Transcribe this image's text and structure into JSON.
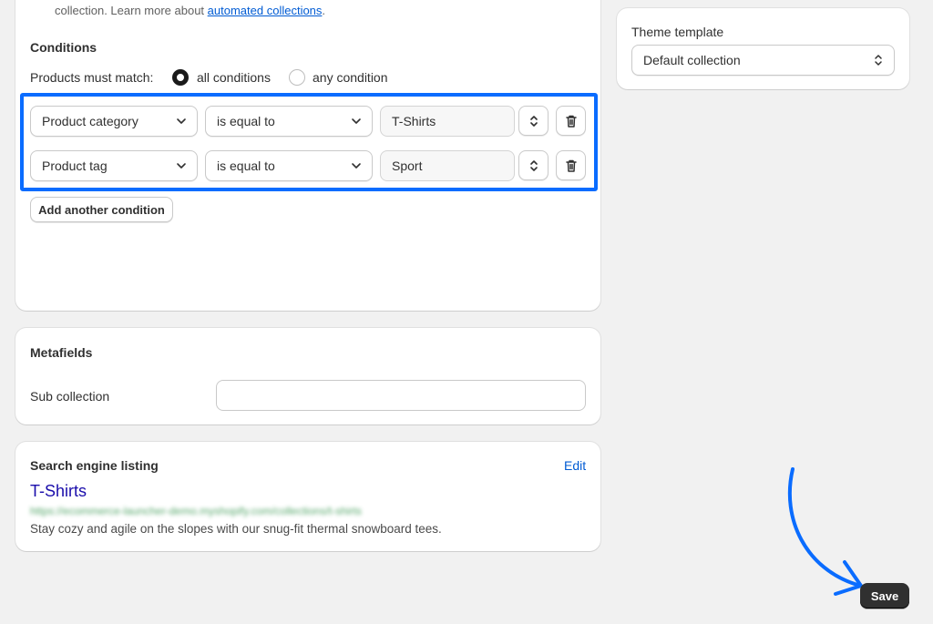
{
  "collection": {
    "intro_text": "collection. Learn more about",
    "intro_link": "automated collections",
    "intro_end": ".",
    "conditions_title": "Conditions",
    "match_label": "Products must match:",
    "match_options": [
      "all conditions",
      "any condition"
    ],
    "selected_match": "all conditions",
    "rows": [
      {
        "field": "Product category",
        "operator": "is equal to",
        "value": "T-Shirts"
      },
      {
        "field": "Product tag",
        "operator": "is equal to",
        "value": "Sport"
      }
    ],
    "add_condition_label": "Add another condition"
  },
  "theme": {
    "label": "Theme template",
    "selected": "Default collection"
  },
  "metafields": {
    "title": "Metafields",
    "sub_collection_label": "Sub collection",
    "sub_collection_value": ""
  },
  "seo": {
    "title": "Search engine listing",
    "edit_label": "Edit",
    "page_title": "T-Shirts",
    "url": "https://ecommerce-launcher-demo.myshopify.com/collections/t-shirts",
    "description": "Stay cozy and agile on the slopes with our snug-fit thermal snowboard tees."
  },
  "actions": {
    "save_label": "Save"
  },
  "colors": {
    "highlight": "#0a6cff",
    "link": "#005bd3",
    "save_bg": "#303030"
  },
  "icons": [
    "chevron-down-icon",
    "selector-icon",
    "trash-icon",
    "annotation-arrow"
  ]
}
